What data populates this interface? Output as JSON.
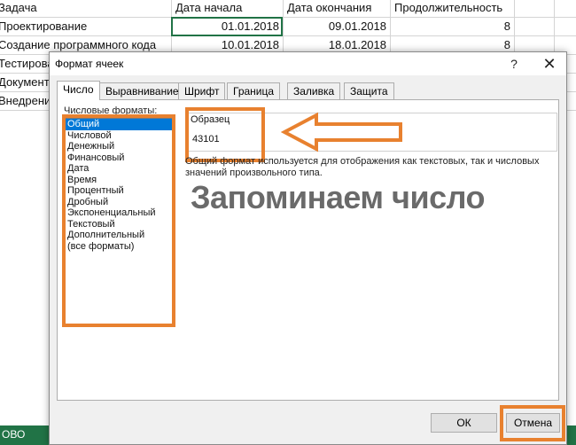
{
  "sheet": {
    "headers": [
      "Задача",
      "Дата начала",
      "Дата окончания",
      "Продолжительность"
    ],
    "rows": [
      [
        "Проектирование",
        "01.01.2018",
        "09.01.2018",
        "8"
      ],
      [
        "Создание программного кода",
        "10.01.2018",
        "18.01.2018",
        "8"
      ]
    ],
    "partial_rows": [
      "Тестирова",
      "Документ",
      "Внедрени"
    ],
    "status_text": "ОВО"
  },
  "dialog": {
    "title": "Формат ячеек",
    "help": "?",
    "close": "✕",
    "tabs": [
      "Число",
      "Выравнивание",
      "Шрифт",
      "Граница",
      "Заливка",
      "Защита"
    ],
    "active_tab": "Число",
    "formats_label": "Числовые форматы:",
    "formats": [
      "Общий",
      "Числовой",
      "Денежный",
      "Финансовый",
      "Дата",
      "Время",
      "Процентный",
      "Дробный",
      "Экспоненциальный",
      "Текстовый",
      "Дополнительный",
      "(все форматы)"
    ],
    "selected_format": "Общий",
    "sample_label": "Образец",
    "sample_value": "43101",
    "description": "Общий формат используется для отображения как текстовых, так и числовых значений произвольного типа.",
    "annotation": "Запоминаем число",
    "ok_label": "ОК",
    "cancel_label": "Отмена"
  },
  "colors": {
    "highlight": "#e8812f",
    "excel_green": "#217346",
    "selection_blue": "#0078d7"
  }
}
